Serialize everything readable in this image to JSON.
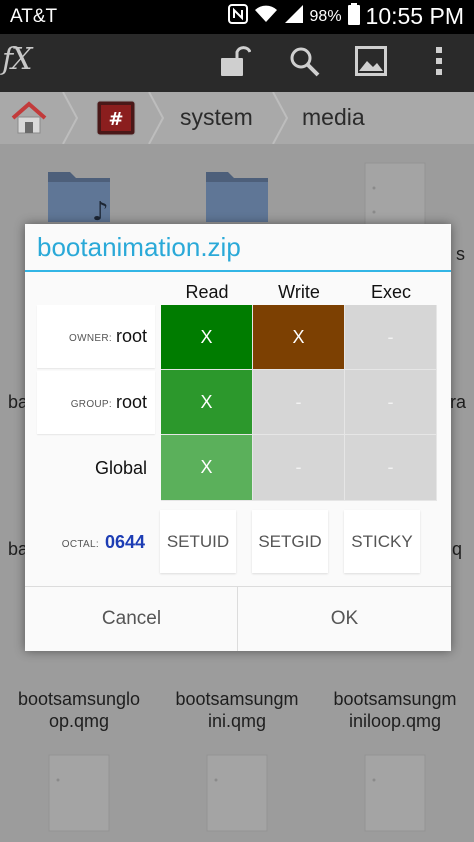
{
  "status_bar": {
    "carrier": "AT&T",
    "battery_pct": "98%",
    "time": "10:55 PM"
  },
  "app_bar": {
    "logo": "fX",
    "actions": [
      "unlock-icon",
      "search-icon",
      "image-icon",
      "overflow-menu-icon"
    ]
  },
  "breadcrumb": {
    "items": [
      "system",
      "media"
    ]
  },
  "files": {
    "row1_partial_left": "ba",
    "row1_partial_right": "ra",
    "row2_partial_left": "ba",
    "row2_partial_right": "q",
    "row3_partial_right": "s",
    "names": [
      {
        "line1": "bootsamsunglo",
        "line2": "op.qmg"
      },
      {
        "line1": "bootsamsungm",
        "line2": "ini.qmg"
      },
      {
        "line1": "bootsamsungm",
        "line2": "iniloop.qmg"
      }
    ]
  },
  "dialog": {
    "title": "bootanimation.zip",
    "columns": [
      "Read",
      "Write",
      "Exec"
    ],
    "owner": {
      "key": "OWNER:",
      "value": "root"
    },
    "group": {
      "key": "GROUP:",
      "value": "root"
    },
    "global_label": "Global",
    "permissions": [
      [
        "X",
        "X",
        "-"
      ],
      [
        "X",
        "-",
        "-"
      ],
      [
        "X",
        "-",
        "-"
      ]
    ],
    "colors": {
      "owner_read": "#007c00",
      "owner_write": "#7c4002",
      "group_read": "#2c982c",
      "global_read": "#5bb05b",
      "off": "#d6d6d6",
      "accent": "#33b5e5"
    },
    "octal": {
      "key": "OCTAL:",
      "value": "0644"
    },
    "flags": [
      "SETUID",
      "SETGID",
      "STICKY"
    ],
    "cancel_label": "Cancel",
    "ok_label": "OK"
  }
}
